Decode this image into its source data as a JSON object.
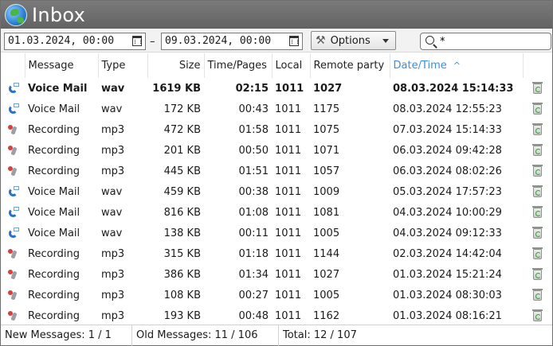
{
  "window": {
    "title": "Inbox",
    "icon": "globe-icon"
  },
  "toolbar": {
    "date_from": "01.03.2024, 00:00",
    "date_separator": "–",
    "date_to": "09.03.2024, 00:00",
    "options_label": "Options",
    "search_value": "*"
  },
  "columns": {
    "message": "Message",
    "type": "Type",
    "size": "Size",
    "time_pages": "Time/Pages",
    "local": "Local",
    "remote": "Remote party",
    "datetime": "Date/Time",
    "sort_indicator": "^"
  },
  "rows": [
    {
      "kind": "voicemail",
      "unread": true,
      "message": "Voice Mail",
      "type": "wav",
      "size": "1619 KB",
      "time": "02:15",
      "local": "1011",
      "remote": "1027",
      "datetime": "08.03.2024 15:14:33"
    },
    {
      "kind": "voicemail",
      "unread": false,
      "message": "Voice Mail",
      "type": "wav",
      "size": "172 KB",
      "time": "00:43",
      "local": "1011",
      "remote": "1175",
      "datetime": "08.03.2024 12:55:23"
    },
    {
      "kind": "recording",
      "unread": false,
      "message": "Recording",
      "type": "mp3",
      "size": "472 KB",
      "time": "01:58",
      "local": "1011",
      "remote": "1075",
      "datetime": "07.03.2024 15:14:33"
    },
    {
      "kind": "recording",
      "unread": false,
      "message": "Recording",
      "type": "mp3",
      "size": "201 KB",
      "time": "00:50",
      "local": "1011",
      "remote": "1071",
      "datetime": "06.03.2024 09:42:28"
    },
    {
      "kind": "recording",
      "unread": false,
      "message": "Recording",
      "type": "mp3",
      "size": "445 KB",
      "time": "01:51",
      "local": "1011",
      "remote": "1057",
      "datetime": "06.03.2024 08:02:26"
    },
    {
      "kind": "voicemail",
      "unread": false,
      "message": "Voice Mail",
      "type": "wav",
      "size": "459 KB",
      "time": "00:38",
      "local": "1011",
      "remote": "1009",
      "datetime": "05.03.2024 17:57:23"
    },
    {
      "kind": "voicemail",
      "unread": false,
      "message": "Voice Mail",
      "type": "wav",
      "size": "816 KB",
      "time": "01:08",
      "local": "1011",
      "remote": "1081",
      "datetime": "04.03.2024 10:00:29"
    },
    {
      "kind": "voicemail",
      "unread": false,
      "message": "Voice Mail",
      "type": "wav",
      "size": "138 KB",
      "time": "00:11",
      "local": "1011",
      "remote": "1005",
      "datetime": "04.03.2024 09:12:33"
    },
    {
      "kind": "recording",
      "unread": false,
      "message": "Recording",
      "type": "mp3",
      "size": "315 KB",
      "time": "01:18",
      "local": "1011",
      "remote": "1144",
      "datetime": "02.03.2024 14:42:04"
    },
    {
      "kind": "recording",
      "unread": false,
      "message": "Recording",
      "type": "mp3",
      "size": "386 KB",
      "time": "01:34",
      "local": "1011",
      "remote": "1027",
      "datetime": "01.03.2024 15:21:24"
    },
    {
      "kind": "recording",
      "unread": false,
      "message": "Recording",
      "type": "mp3",
      "size": "108 KB",
      "time": "00:27",
      "local": "1011",
      "remote": "1005",
      "datetime": "01.03.2024 08:30:03"
    },
    {
      "kind": "recording",
      "unread": false,
      "message": "Recording",
      "type": "mp3",
      "size": "193 KB",
      "time": "00:48",
      "local": "1011",
      "remote": "1162",
      "datetime": "01.03.2024 08:16:21"
    }
  ],
  "status": {
    "new_messages": "New Messages: 1 / 1",
    "old_messages": "Old Messages: 11 / 106",
    "total": "Total: 12 / 107"
  },
  "colors": {
    "titlebar": "#6b6b6b",
    "sort_accent": "#3a8ee0",
    "voicemail_icon": "#2a72c9",
    "recording_icon": "#d84040"
  },
  "icons": {
    "voicemail": "voicemail-icon",
    "recording": "recording-icon",
    "delete": "trash-icon",
    "options": "tools-icon",
    "search": "search-icon",
    "calendar": "calendar-icon"
  }
}
